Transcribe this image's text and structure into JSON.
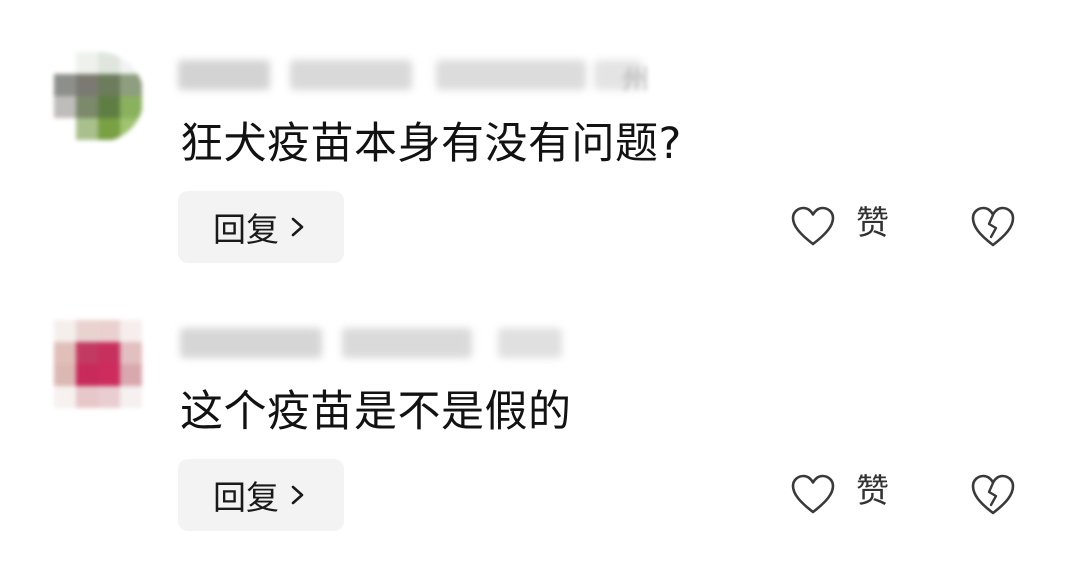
{
  "comments": [
    {
      "author_blurred": "",
      "location": "州",
      "text": "狂犬疫苗本身有没有问题?",
      "reply_label": "回复",
      "like_label": "赞"
    },
    {
      "author_blurred": "",
      "location": "",
      "text": "这个疫苗是不是假的",
      "reply_label": "回复",
      "like_label": "赞"
    }
  ],
  "icons": {
    "reply_chevron": "chevron-right-icon",
    "like": "heart-outline-icon",
    "dislike": "broken-heart-icon"
  },
  "colors": {
    "reply_bg": "#f3f3f3",
    "icon_stroke": "#3a3a3a",
    "text": "#121212"
  }
}
